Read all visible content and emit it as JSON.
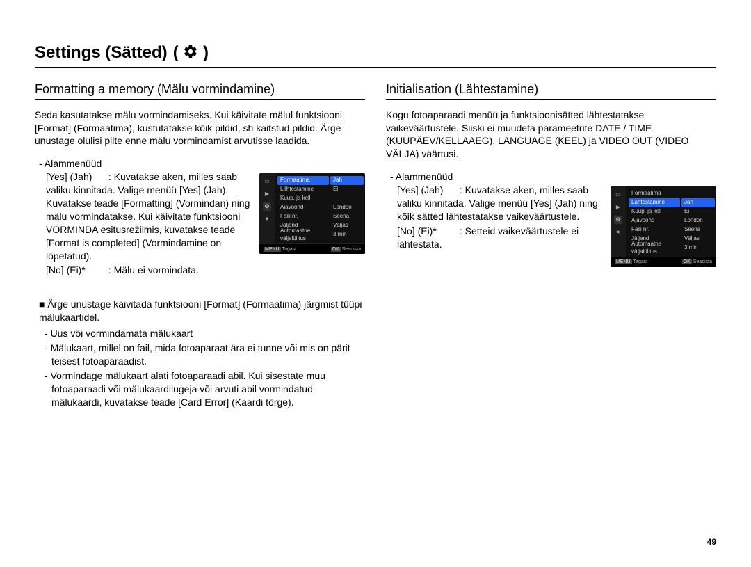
{
  "title": "Settings (Sätted)",
  "page_number": "49",
  "left": {
    "heading": "Formatting a memory (Mälu vormindamine)",
    "intro": "Seda kasutatakse mälu vormindamiseks. Kui käivitate mälul funktsiooni [Format] (Formaatima), kustutatakse kõik pildid, sh kaitstud pildid. Ärge unustage olulisi pilte enne mälu vormindamist arvutisse laadida.",
    "submenu_label": "- Alammenüüd",
    "yes_label": "[Yes] (Jah)",
    "yes_desc": ": Kuvatakse aken, milles saab valiku kinnitada. Valige menüü [Yes] (Jah). Kuvatakse teade [Formatting] (Vormindan) ning mälu vormindatakse. Kui käivitate funktsiooni VORMINDA esitusrežiimis, kuvatakse teade [Format is completed] (Vormindamine on lõpetatud).",
    "no_label": "[No] (Ei)*",
    "no_desc": ": Mälu ei vormindata.",
    "note_lead": "■ Ärge unustage käivitada funktsiooni [Format] (Formaatima) järgmist tüüpi mälukaartidel.",
    "note_items": [
      "Uus või vormindamata mälukaart",
      "Mälukaart, millel on fail, mida fotoaparaat ära ei tunne või mis on pärit teisest fotoaparaadist.",
      "Vormindage mälukaart alati fotoaparaadi abil. Kui sisestate muu fotoaparaadi või mälukaardilugeja või arvuti abil vormindatud mälukaardi, kuvatakse teade [Card Error] (Kaardi tõrge)."
    ],
    "menu": {
      "rows": [
        "Formaatima",
        "Lähtestamine",
        "Kuup. ja kell",
        "Ajavöönd",
        "Faili nr.",
        "Jäljend",
        "Automaatne väljalülitus"
      ],
      "values": [
        "",
        "",
        "",
        "London",
        "Seeria",
        "Väljas",
        "3 min"
      ],
      "highlight_row": 0,
      "option_a": "Jah",
      "option_b": "Ei",
      "highlight_option": "a",
      "foot_left_key": "MENU",
      "foot_left": "Tagasi",
      "foot_right_key": "OK",
      "foot_right": "Seadista"
    }
  },
  "right": {
    "heading": "Initialisation (Lähtestamine)",
    "intro": "Kogu fotoaparaadi menüü ja funktsioonisätted lähtestatakse vaikeväärtustele. Siiski ei muudeta parameetrite DATE / TIME (KUUPÄEV/KELLAAEG), LANGUAGE (KEEL) ja VIDEO OUT (VIDEO VÄLJA) väärtusi.",
    "submenu_label": "- Alammenüüd",
    "yes_label": "[Yes] (Jah)",
    "yes_desc": ": Kuvatakse aken, milles saab valiku kinnitada. Valige menüü [Yes] (Jah) ning kõik sätted lähtestatakse vaikeväärtustele.",
    "no_label": "[No] (Ei)*",
    "no_desc": ": Setteid vaikeväärtustele ei lähtestata.",
    "menu": {
      "rows": [
        "Formaatima",
        "Lähtestamine",
        "Kuup. ja kell",
        "Ajavöönd",
        "Faili nr.",
        "Jäljend",
        "Automaatne väljalülitus"
      ],
      "values": [
        "",
        "",
        "",
        "London",
        "Seeria",
        "Väljas",
        "3 min"
      ],
      "highlight_row": 1,
      "option_a": "Jah",
      "option_b": "Ei",
      "highlight_option": "a",
      "foot_left_key": "MENU",
      "foot_left": "Tagasi",
      "foot_right_key": "OK",
      "foot_right": "Seadista"
    }
  }
}
